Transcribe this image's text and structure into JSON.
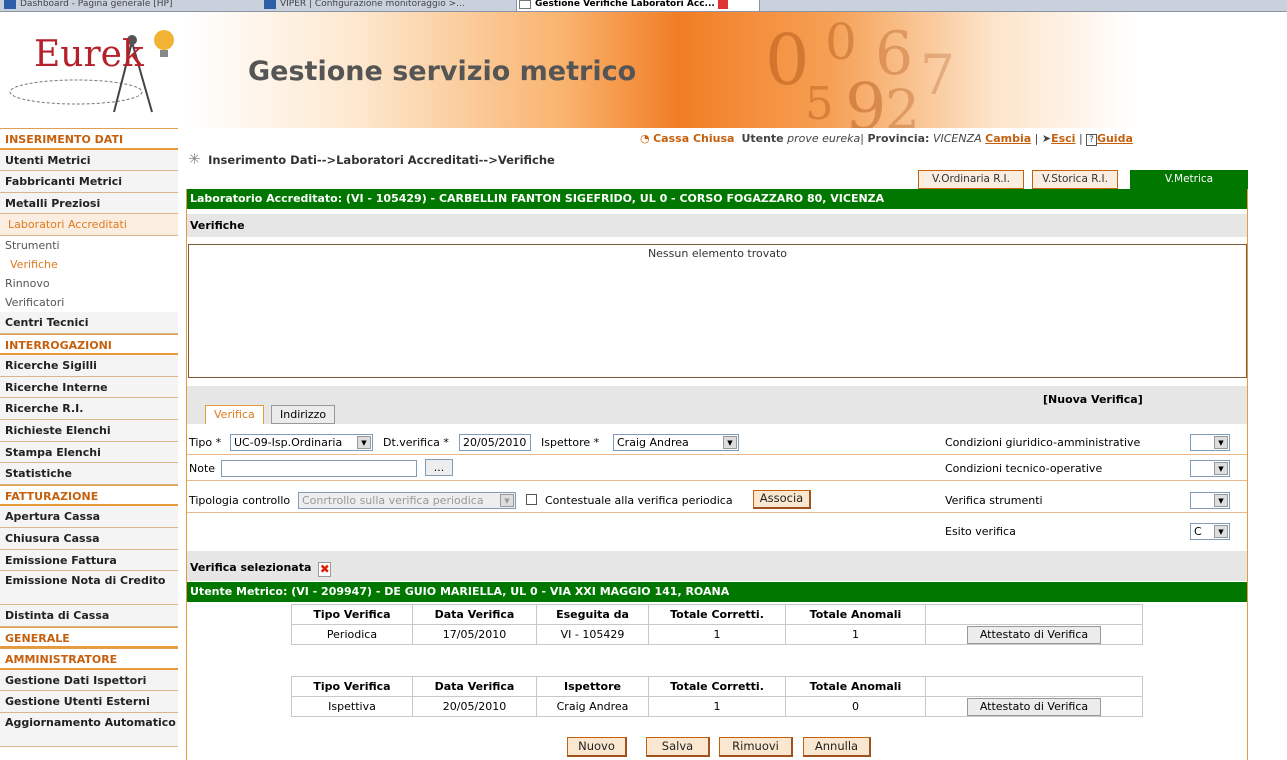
{
  "browser_tabs": [
    {
      "label": "Dashboard - Pagina generale [HP]"
    },
    {
      "label": "VIPER | Configurazione monitoraggio >..."
    },
    {
      "label": "Gestione Verifiche Laboratori Acc..."
    }
  ],
  "header": {
    "logo_text": "Eurek",
    "title": "Gestione servizio metrico"
  },
  "sidebar": {
    "inserimento": "INSERIMENTO DATI",
    "utenti_metrici": "Utenti Metrici",
    "fabbricanti": "Fabbricanti Metrici",
    "metalli": "Metalli Preziosi",
    "laboratori": "Laboratori Accreditati",
    "strumenti": "Strumenti",
    "verifiche": "Verifiche",
    "rinnovo": "Rinnovo",
    "verificatori": "Verificatori",
    "centri": "Centri Tecnici",
    "interrogazioni": "INTERROGAZIONI",
    "sigilli": "Ricerche Sigilli",
    "interne": "Ricerche Interne",
    "ri": "Ricerche R.I.",
    "richieste": "Richieste Elenchi",
    "stampa": "Stampa Elenchi",
    "statistiche": "Statistiche",
    "fatturazione": "FATTURAZIONE",
    "apertura": "Apertura Cassa",
    "chiusura": "Chiusura Cassa",
    "emissione": "Emissione Fattura",
    "nota": "Emissione Nota di Credito",
    "distinta": "Distinta di Cassa",
    "generale": "GENERALE",
    "amministratore": "AMMINISTRATORE",
    "ispettori": "Gestione Dati Ispettori",
    "esterni": "Gestione Utenti Esterni",
    "aggiornamento": "Aggiornamento Automatico"
  },
  "topbar": {
    "cassa": "Cassa Chiusa",
    "utente_label": "Utente",
    "utente_value": "prove eureka",
    "provincia_label": "Provincia:",
    "provincia_value": "VICENZA",
    "cambia": "Cambia",
    "esci": "Esci",
    "guida": "Guida"
  },
  "breadcrumb": "Inserimento Dati-->Laboratori Accreditati-->Verifiche",
  "view_tabs": {
    "ordinaria": "V.Ordinaria R.I.",
    "storica": "V.Storica R.I.",
    "metrica": "V.Metrica"
  },
  "lab_bar": "Laboratorio Accreditato: (VI - 105429) - CARBELLIN FANTON SIGEFRIDO, UL 0 - CORSO FOGAZZARO 80, VICENZA",
  "verifiche_title": "Verifiche",
  "empty_message": "Nessun elemento trovato",
  "form": {
    "tab_verifica": "Verifica",
    "tab_indirizzo": "Indirizzo",
    "nuova": "[Nuova Verifica]",
    "tipo_label": "Tipo *",
    "tipo_value": "UC-09-Isp.Ordinaria",
    "dt_label": "Dt.verifica *",
    "dt_value": "20/05/2010",
    "ispettore_label": "Ispettore *",
    "ispettore_value": "Craig Andrea",
    "note_label": "Note",
    "note_value": "",
    "dots": "...",
    "tipologia_label": "Tipologia controllo",
    "tipologia_value": "Conrtrollo sulla verifica periodica",
    "contestuale_label": "Contestuale alla verifica periodica",
    "associa": "Associa",
    "cond_giuridico": "Condizioni giuridico-amministrative",
    "cond_tecnico": "Condizioni tecnico-operative",
    "verifica_strumenti": "Verifica strumenti",
    "esito": "Esito verifica",
    "esito_value": "C"
  },
  "selezionata_title": "Verifica selezionata",
  "utente_bar": "Utente Metrico: (VI - 209947) - DE GUIO MARIELLA, UL 0 - VIA XXI MAGGIO 141, ROANA",
  "table1": {
    "headers": [
      "Tipo Verifica",
      "Data Verifica",
      "Eseguita da",
      "Totale Corretti.",
      "Totale Anomali"
    ],
    "row": [
      "Periodica",
      "17/05/2010",
      "VI - 105429",
      "1",
      "1"
    ],
    "action": "Attestato di Verifica"
  },
  "table2": {
    "headers": [
      "Tipo Verifica",
      "Data Verifica",
      "Ispettore",
      "Totale Corretti.",
      "Totale Anomali"
    ],
    "row": [
      "Ispettiva",
      "20/05/2010",
      "Craig Andrea",
      "1",
      "0"
    ],
    "action": "Attestato di Verifica"
  },
  "actions": {
    "nuovo": "Nuovo",
    "salva": "Salva",
    "rimuovi": "Rimuovi",
    "annulla": "Annulla"
  },
  "colors": {
    "accent": "#e07a1c",
    "green": "#007800",
    "section": "#c5600e"
  }
}
